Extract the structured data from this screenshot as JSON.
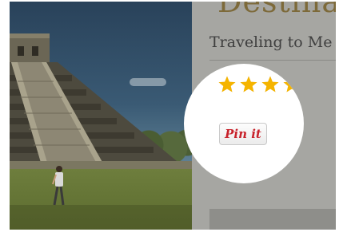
{
  "page": {
    "title": "Destina",
    "subtitle": "Traveling to Me"
  },
  "rating": {
    "value": 4.5,
    "max": 5,
    "star_color": "#f5b400",
    "empty_color": "#d8d8d8"
  },
  "pin_button": {
    "label": "Pin it",
    "color": "#c8232c"
  },
  "icons": [
    "star-icon",
    "pin-it-logo"
  ]
}
